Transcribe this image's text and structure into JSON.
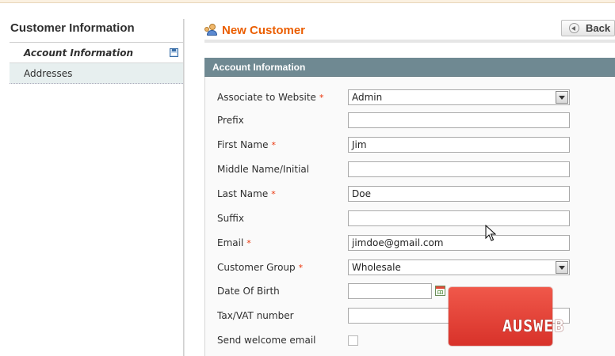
{
  "sidebar": {
    "title": "Customer Information",
    "items": [
      {
        "label": "Account Information",
        "active": true
      },
      {
        "label": "Addresses",
        "active": false
      }
    ]
  },
  "header": {
    "title": "New Customer",
    "back_label": "Back"
  },
  "section": {
    "title": "Account Information"
  },
  "form": {
    "required_mark": "*",
    "website": {
      "label": "Associate to Website",
      "value": "Admin"
    },
    "prefix": {
      "label": "Prefix",
      "value": ""
    },
    "first_name": {
      "label": "First Name",
      "value": "Jim"
    },
    "middle_name": {
      "label": "Middle Name/Initial",
      "value": ""
    },
    "last_name": {
      "label": "Last Name",
      "value": "Doe"
    },
    "suffix": {
      "label": "Suffix",
      "value": ""
    },
    "email": {
      "label": "Email",
      "value": "jimdoe@gmail.com"
    },
    "customer_group": {
      "label": "Customer Group",
      "value": "Wholesale"
    },
    "dob": {
      "label": "Date Of Birth",
      "value": ""
    },
    "taxvat": {
      "label": "Tax/VAT number",
      "value": ""
    },
    "welcome_email": {
      "label": "Send welcome email",
      "checked": false
    }
  },
  "watermark": {
    "text": "AUSWEB"
  },
  "colors": {
    "title_orange": "#eb5e00",
    "section_header": "#6f8992",
    "required_red": "#eb340a"
  }
}
